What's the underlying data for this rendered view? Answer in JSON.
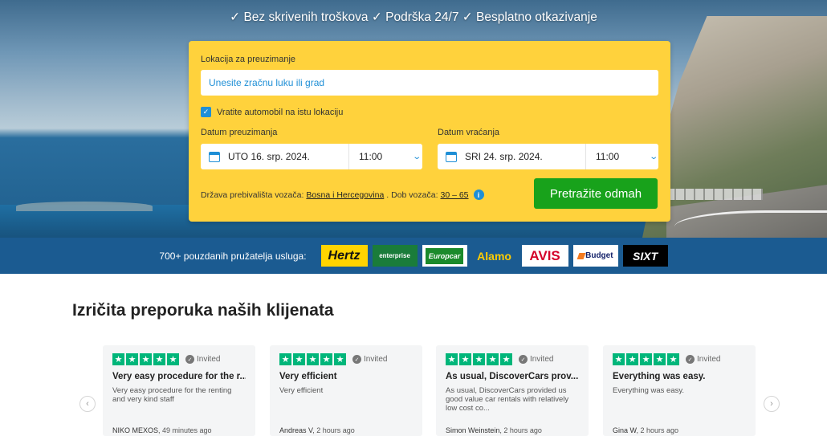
{
  "hero": {
    "tagline": "✓ Bez skrivenih troškova ✓ Podrška 24/7 ✓ Besplatno otkazivanje"
  },
  "search": {
    "location_label": "Lokacija za preuzimanje",
    "location_placeholder": "Unesite zračnu luku ili grad",
    "same_location_label": "Vratite automobil na istu lokaciju",
    "same_location_checked": true,
    "pickup_label": "Datum preuzimanja",
    "pickup_date": "UTO 16. srp. 2024.",
    "pickup_time": "11:00",
    "return_label": "Datum vraćanja",
    "return_date": "SRI 24. srp. 2024.",
    "return_time": "11:00",
    "residence_prefix": "Država prebivališta vozača:",
    "residence_country": "Bosna i Hercegovina",
    "age_prefix": ". Dob vozača:",
    "age_range": "30 – 65",
    "submit_label": "Pretražite odmah"
  },
  "providers": {
    "text": "700+ pouzdanih pružatelja usluga:",
    "logos": [
      "Hertz",
      "enterprise",
      "Europcar",
      "Alamo",
      "AVIS",
      "Budget",
      "SIXT"
    ]
  },
  "reviews": {
    "title": "Izričita preporuka naših klijenata",
    "invited_label": "Invited",
    "items": [
      {
        "title": "Very easy procedure for the r...",
        "body": "Very easy procedure for the renting and very kind staff",
        "author": "NIKO MEXOS",
        "time": ", 49 minutes ago",
        "stars": 5
      },
      {
        "title": "Very efficient",
        "body": "Very efficient",
        "author": "Andreas V",
        "time": ", 2 hours ago",
        "stars": 5
      },
      {
        "title": "As usual, DiscoverCars prov...",
        "body": "As usual, DiscoverCars provided us good value car rentals with relatively low cost co...",
        "author": "Simon Weinstein",
        "time": ", 2 hours ago",
        "stars": 5
      },
      {
        "title": "Everything was easy.",
        "body": "Everything was easy.",
        "author": "Gina W",
        "time": ", 2 hours ago",
        "stars": 5
      }
    ]
  },
  "colors": {
    "card_bg": "#ffd23c",
    "accent_blue": "#1f8fd6",
    "search_button": "#18a21b",
    "providers_bar": "#1b5b91",
    "trustpilot_green": "#00b67a"
  },
  "icons": {
    "calendar": "calendar-icon",
    "chevron": "chevron-down-icon",
    "info": "info-icon",
    "prev": "chevron-left-icon",
    "next": "chevron-right-icon",
    "star": "star-icon"
  }
}
